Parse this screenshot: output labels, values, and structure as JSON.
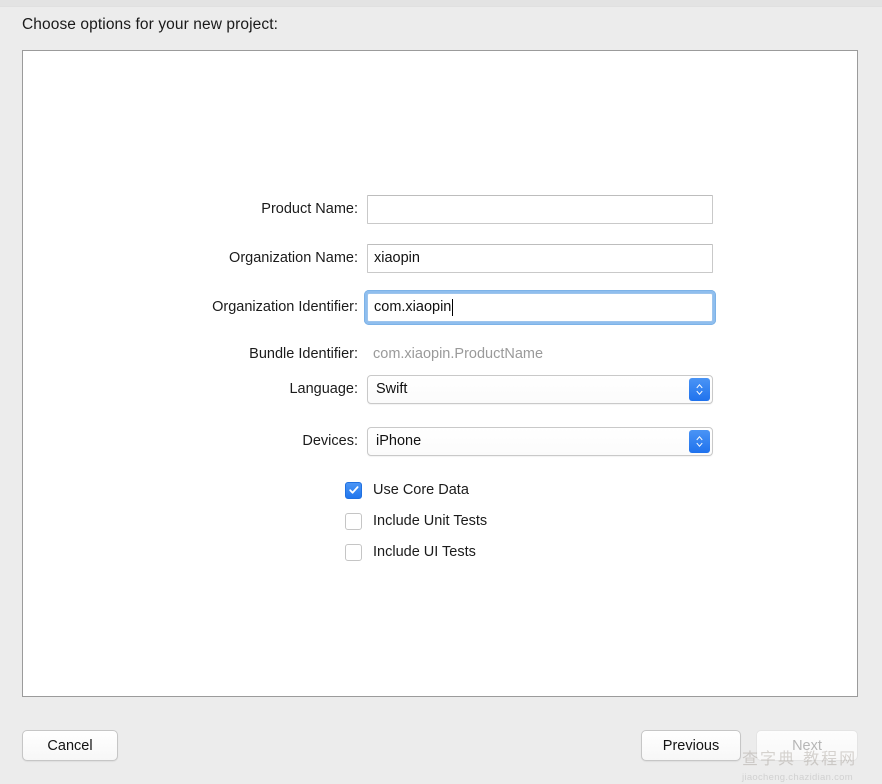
{
  "dialog": {
    "title": "Choose options for your new project:"
  },
  "form": {
    "fields": [
      {
        "label": "Product Name:",
        "value": "",
        "type": "text"
      },
      {
        "label": "Organization Name:",
        "value": "xiaopin",
        "type": "text"
      },
      {
        "label": "Organization Identifier:",
        "value": "com.xiaopin",
        "type": "text-focused"
      },
      {
        "label": "Bundle Identifier:",
        "value": "com.xiaopin.ProductName",
        "type": "static"
      },
      {
        "label": "Language:",
        "value": "Swift",
        "type": "popup"
      },
      {
        "label": "Devices:",
        "value": "iPhone",
        "type": "popup"
      }
    ],
    "checkboxes": [
      {
        "label": "Use Core Data",
        "checked": true
      },
      {
        "label": "Include Unit Tests",
        "checked": false
      },
      {
        "label": "Include UI Tests",
        "checked": false
      }
    ]
  },
  "buttons": {
    "cancel": "Cancel",
    "previous": "Previous",
    "next": "Next"
  },
  "watermark": {
    "cn": "查字典 教程网",
    "url": "jiaocheng.chazidian.com"
  },
  "colors": {
    "accent_blue": "#2f80f0",
    "focus_ring": "#8fbeee",
    "window_bg": "#ececec",
    "panel_bg": "#ffffff",
    "panel_border": "#9b9b9b",
    "muted_text": "#9a9a9a",
    "disabled_text": "#b6b6b6"
  }
}
